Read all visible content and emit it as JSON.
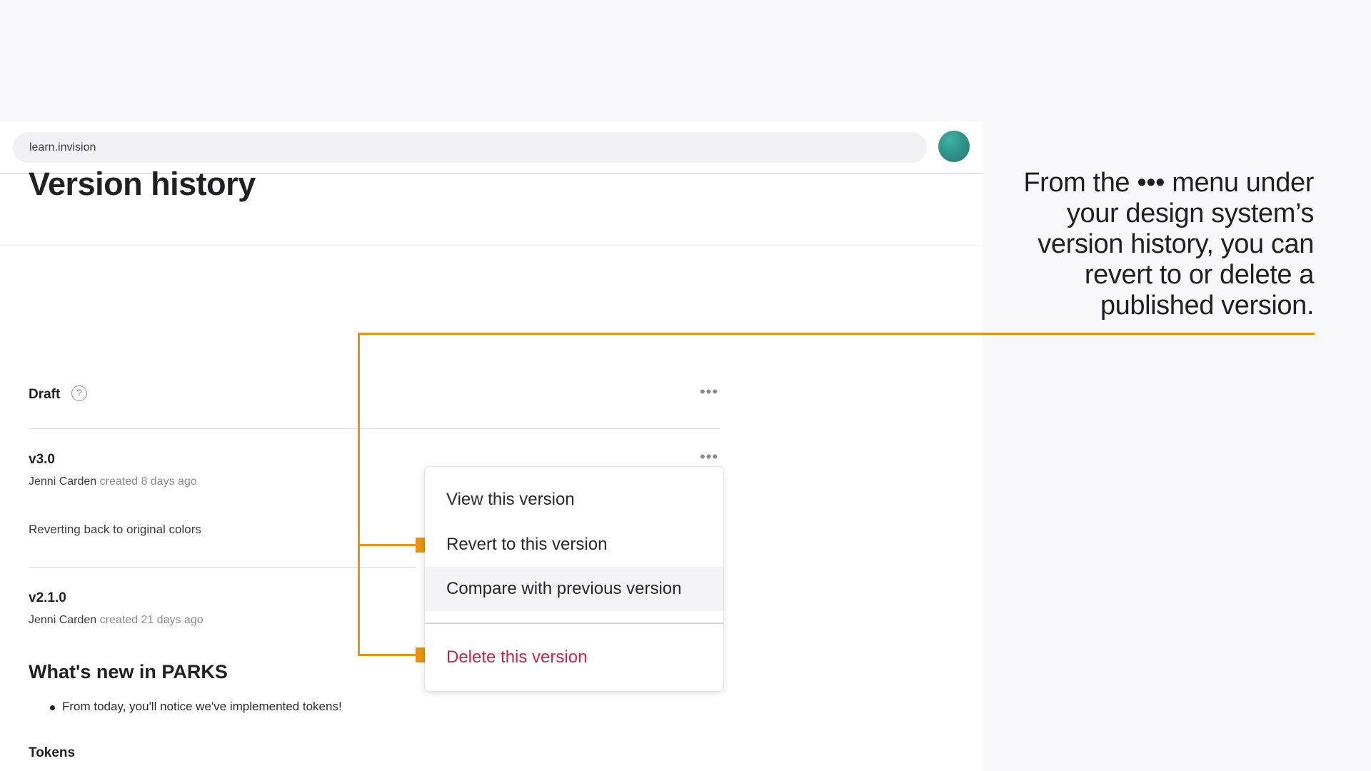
{
  "browser": {
    "url": "learn.invision",
    "avatar_color": "#2f8f86"
  },
  "page": {
    "title": "Version history"
  },
  "versions": [
    {
      "label": "Draft",
      "help_icon": "question-circle-icon"
    },
    {
      "label": "v3.0",
      "author": "Jenni Carden",
      "created": "created 8 days ago",
      "note": "Reverting back to original colors"
    },
    {
      "label": "v2.1.0",
      "author": "Jenni Carden",
      "created": "created 21 days ago"
    }
  ],
  "release_notes": {
    "heading": "What's new in PARKS",
    "bullets": [
      "From today, you'll notice we've implemented tokens!"
    ],
    "subheading": "Tokens"
  },
  "menu": {
    "kebab_icon": "more-horizontal-icon",
    "items": [
      {
        "label": "View this version"
      },
      {
        "label": "Revert to this version"
      },
      {
        "label": "Compare with previous version"
      },
      {
        "label": "Delete this version"
      }
    ],
    "danger_color": "#d3224a"
  },
  "caption": {
    "text": "From the ••• menu under your design system’s version history, you can revert to or delete a published version."
  },
  "annotation": {
    "color": "#e8940f"
  }
}
